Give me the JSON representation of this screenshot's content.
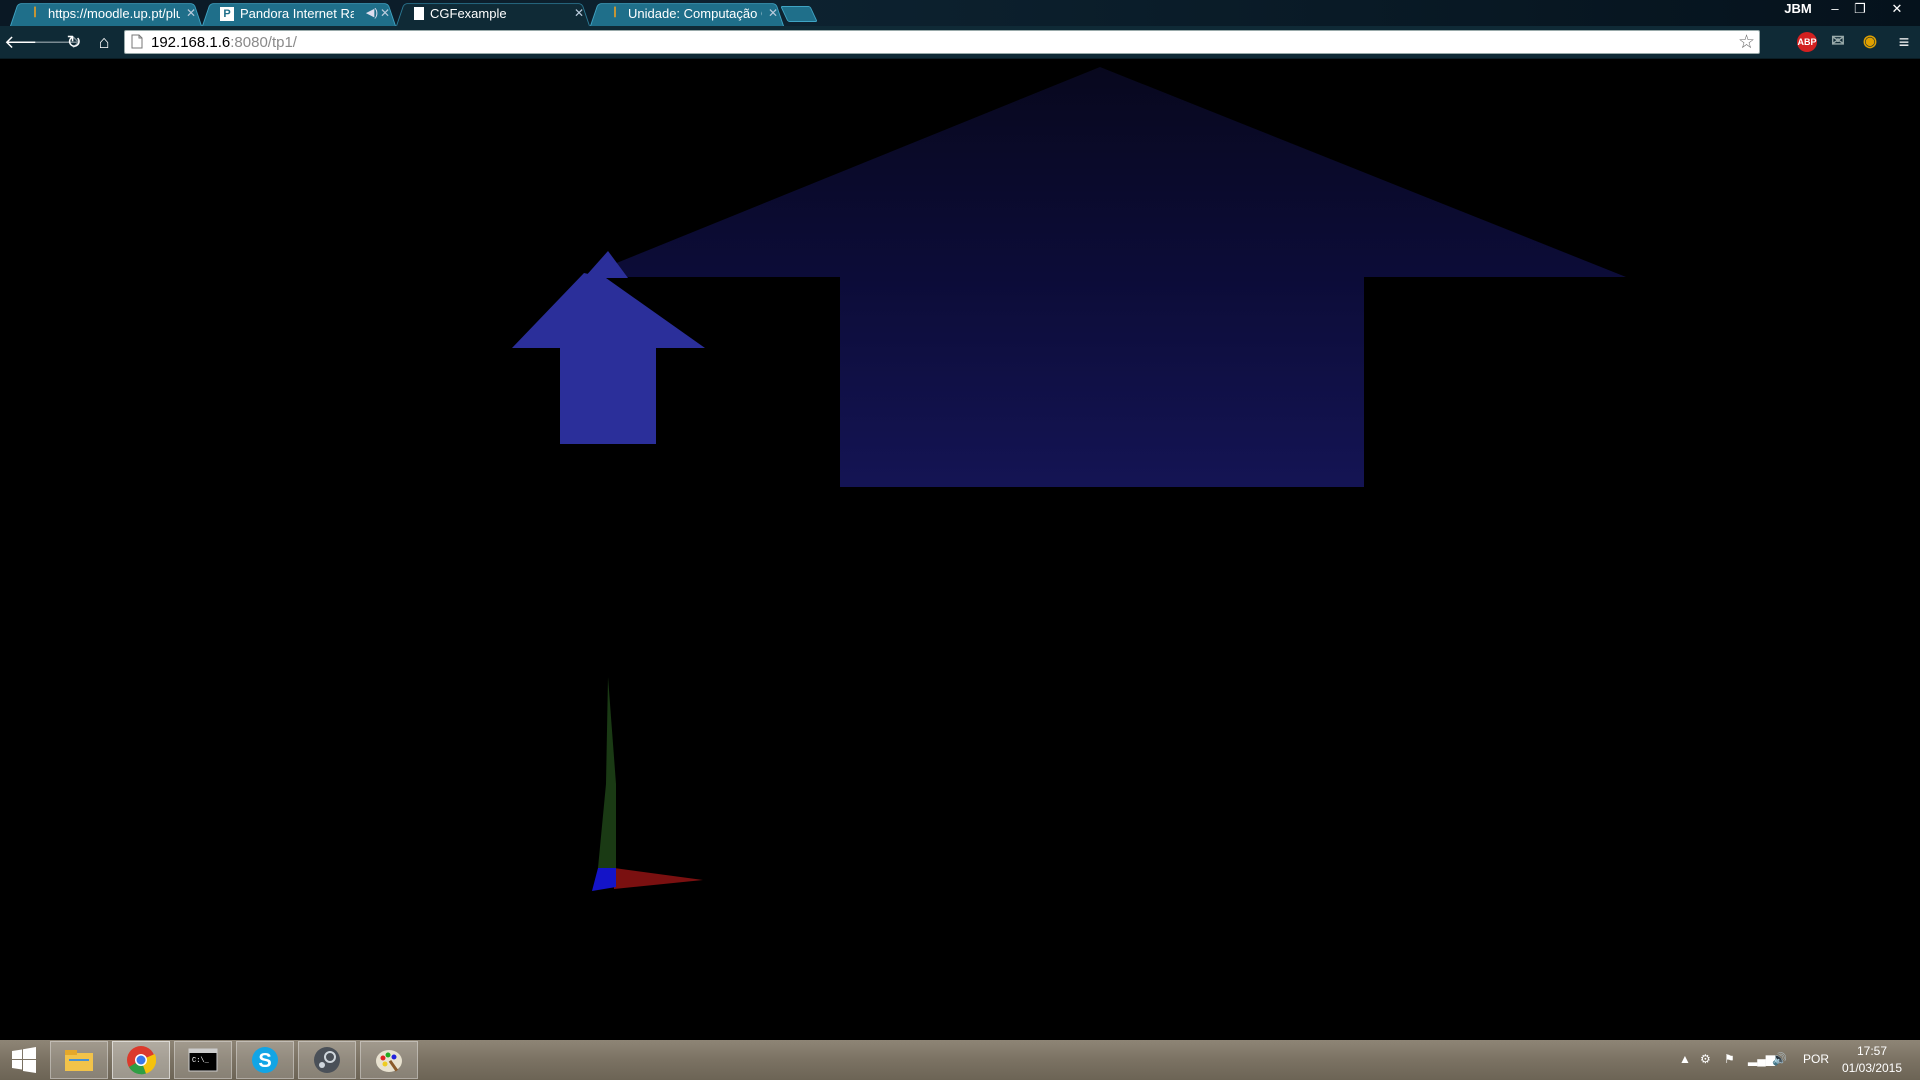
{
  "browser": {
    "tabs": [
      {
        "title": "https://moodle.up.pt/plu",
        "favicon": "moodle-icon",
        "active": false,
        "audio": false
      },
      {
        "title": "Pandora Internet Radio",
        "favicon": "pandora-icon",
        "active": false,
        "audio": true
      },
      {
        "title": "CGFexample",
        "favicon": "page-icon",
        "active": true,
        "audio": false
      },
      {
        "title": "Unidade: Computação Gr",
        "favicon": "moodle-icon",
        "active": false,
        "audio": false
      }
    ],
    "user": "JBM",
    "window_buttons": {
      "minimize": "–",
      "restore": "❐",
      "close": "✕"
    },
    "address": {
      "host": "192.168.1.6",
      "rest": ":8080/tp1/"
    },
    "extensions": [
      {
        "name": "adblock-plus-icon",
        "label": "ABP",
        "color": "#d32020"
      },
      {
        "name": "mail-icon",
        "label": "✉",
        "color": "#8a9aa2"
      },
      {
        "name": "extension-icon",
        "label": "◉",
        "color": "#e0a000"
      }
    ]
  },
  "scene": {
    "house_color": "#0e0e4a",
    "small_house_color": "#2b2f9a",
    "axis_colors": {
      "x": "#7a1010",
      "y": "#1a3a14",
      "z": "#1414c8"
    }
  },
  "taskbar": {
    "apps": [
      {
        "name": "file-explorer-icon",
        "state": "pinned"
      },
      {
        "name": "chrome-icon",
        "state": "active"
      },
      {
        "name": "command-prompt-icon",
        "state": "pinned"
      },
      {
        "name": "skype-icon",
        "state": "pinned"
      },
      {
        "name": "steam-icon",
        "state": "pinned"
      },
      {
        "name": "paint-icon",
        "state": "pinned"
      }
    ],
    "language": "POR",
    "time": "17:57",
    "date": "01/03/2015"
  }
}
